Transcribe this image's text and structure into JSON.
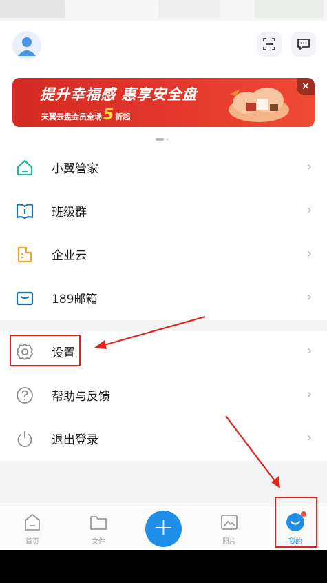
{
  "banner": {
    "title": "提升幸福感 惠享安全盘",
    "subtitle_prefix": "天翼云盘会员全场",
    "subtitle_num": "5",
    "subtitle_suffix": "折起",
    "close": "✕"
  },
  "menu_group_1": [
    {
      "label": "小翼管家",
      "icon": "home-icon"
    },
    {
      "label": "班级群",
      "icon": "book-icon"
    },
    {
      "label": "企业云",
      "icon": "building-icon"
    },
    {
      "label": "189邮箱",
      "icon": "mail-icon"
    }
  ],
  "menu_group_2": [
    {
      "label": "设置",
      "icon": "gear-icon"
    },
    {
      "label": "帮助与反馈",
      "icon": "help-icon"
    },
    {
      "label": "退出登录",
      "icon": "power-icon"
    }
  ],
  "chevron": "›",
  "tabs": [
    {
      "label": "首页",
      "icon": "home-tab-icon"
    },
    {
      "label": "文件",
      "icon": "folder-icon"
    },
    {
      "label": "",
      "icon": "plus-icon"
    },
    {
      "label": "照片",
      "icon": "photo-icon"
    },
    {
      "label": "我的",
      "icon": "profile-icon"
    }
  ],
  "fab_symbol": "+",
  "colors": {
    "accent": "#1e8fe8",
    "annotation": "#e2231a",
    "banner": "#e5372c",
    "home_icon": "#27b29a",
    "building_icon": "#f0a22b",
    "mail_icon": "#1d6fb8"
  }
}
